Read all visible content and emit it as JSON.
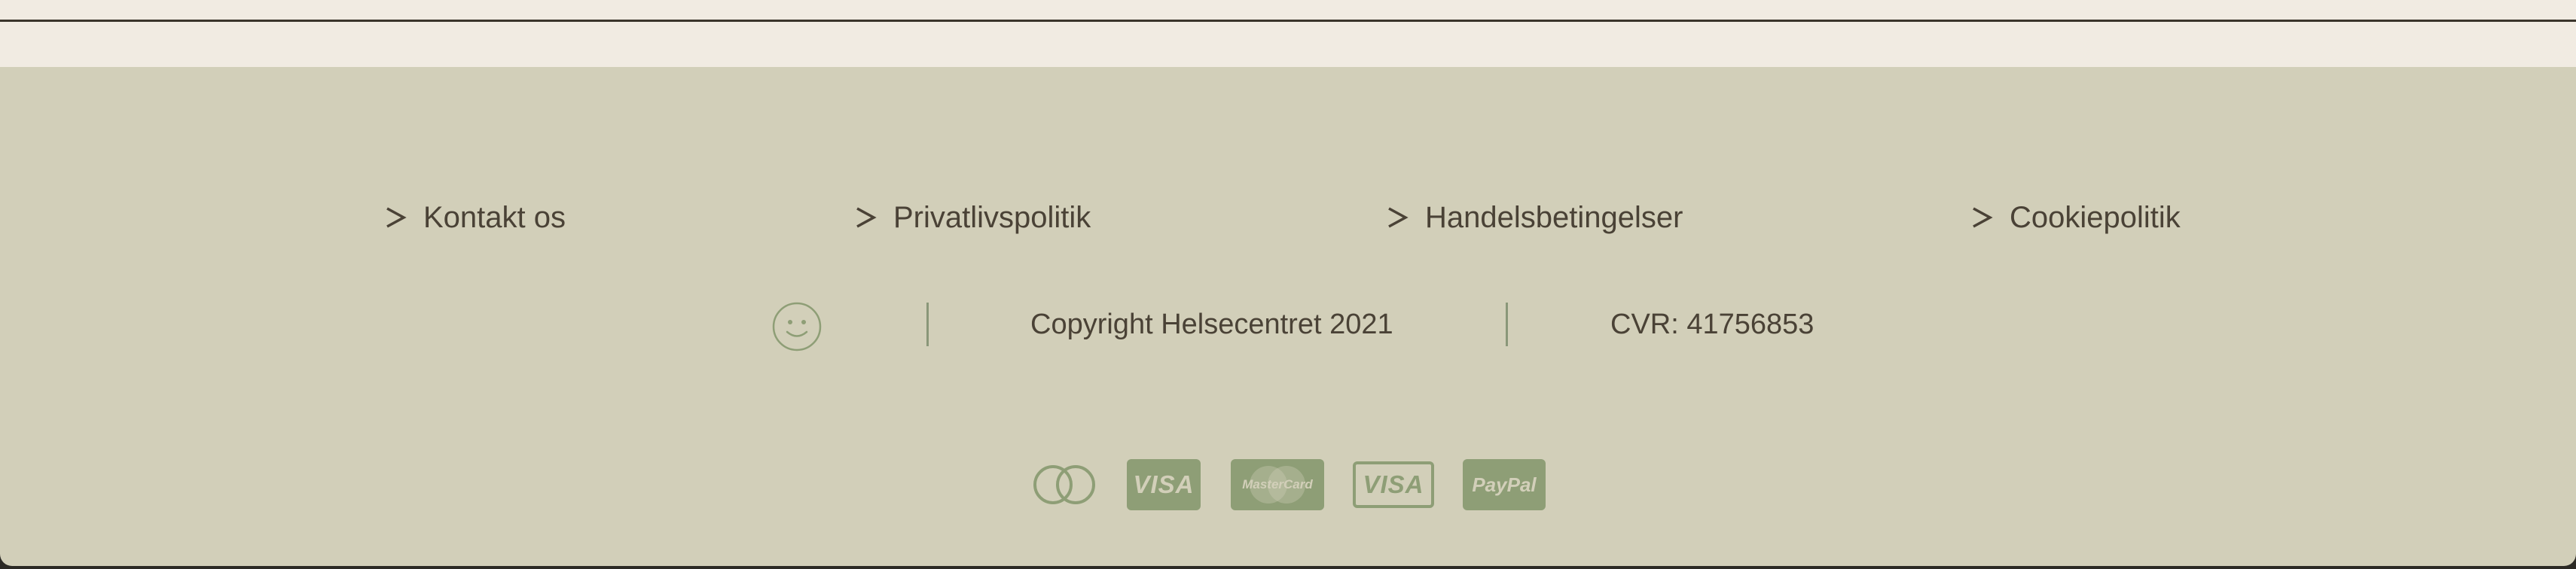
{
  "footer": {
    "links": [
      {
        "label": "Kontakt os",
        "icon": "chevron-right-icon"
      },
      {
        "label": "Privatlivspolitik",
        "icon": "chevron-right-icon"
      },
      {
        "label": "Handelsbetingelser",
        "icon": "chevron-right-icon"
      },
      {
        "label": "Cookiepolitik",
        "icon": "chevron-right-icon"
      }
    ],
    "smiley_icon": "smiley-face-icon",
    "copyright": "Copyright Helsecentret 2021",
    "cvr": "CVR: 41756853",
    "payments": [
      {
        "name": "mastercard-circles-icon"
      },
      {
        "name": "visa-card-icon",
        "label": "VISA"
      },
      {
        "name": "mastercard-card-icon",
        "label": "MasterCard"
      },
      {
        "name": "visa-outline-card-icon",
        "label": "VISA"
      },
      {
        "name": "paypal-card-icon",
        "label": "PayPal"
      }
    ]
  },
  "colors": {
    "footer_bg": "#d2cfb9",
    "cream_band": "#f1ebe2",
    "text": "#4a4236",
    "accent_green": "#8e9e76",
    "dark_edge": "#2c2a25"
  }
}
